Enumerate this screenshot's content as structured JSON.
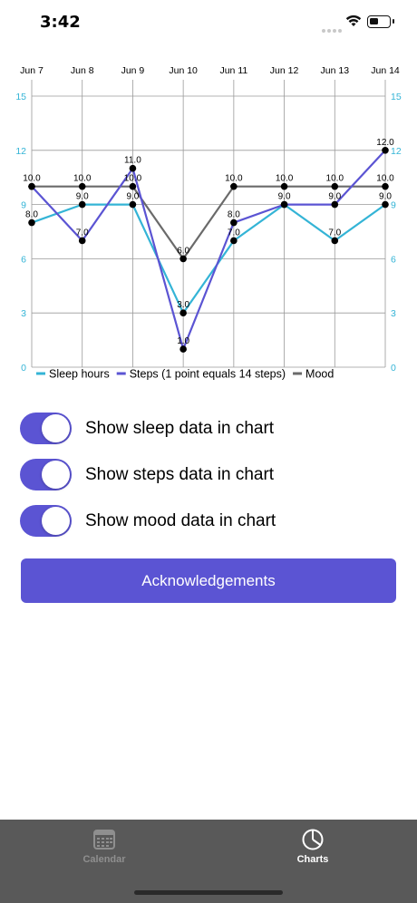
{
  "status": {
    "time": "3:42"
  },
  "chart_data": {
    "type": "line",
    "categories": [
      "Jun 7",
      "Jun 8",
      "Jun 9",
      "Jun 10",
      "Jun 11",
      "Jun 12",
      "Jun 13",
      "Jun 14"
    ],
    "ylim": [
      0,
      15
    ],
    "y_ticks": [
      "0",
      "3",
      "6",
      "9",
      "12",
      "15"
    ],
    "grid": true,
    "legend_position": "bottom",
    "series": [
      {
        "name": "Sleep hours",
        "color": "#34b4d6",
        "values": [
          8,
          9,
          9,
          3,
          7,
          9,
          7,
          9
        ]
      },
      {
        "name": "Steps (1 point equals 14 steps)",
        "color": "#5b54d3",
        "values": [
          10,
          7,
          11,
          1,
          8,
          9,
          9,
          12
        ]
      },
      {
        "name": "Mood",
        "color": "#6a6a6a",
        "values": [
          10,
          10,
          10,
          6,
          10,
          10,
          10,
          10
        ]
      }
    ],
    "value_labels": [
      [
        "10.0",
        "8.0"
      ],
      [
        "10.0",
        "9.0",
        "7.0"
      ],
      [
        "11.0",
        "10.0",
        "9.0"
      ],
      [
        "6.0",
        "3.0",
        "1.0"
      ],
      [
        "10.0",
        "8.0",
        "7.0"
      ],
      [
        "10.0",
        "9.0"
      ],
      [
        "10.0",
        "9.0",
        "7.0"
      ],
      [
        "12.0",
        "10.0",
        "9.0"
      ]
    ]
  },
  "toggles": [
    {
      "label": "Show sleep data in chart",
      "on": true
    },
    {
      "label": "Show steps data in chart",
      "on": true
    },
    {
      "label": "Show mood data in chart",
      "on": true
    }
  ],
  "acknowledgements_label": "Acknowledgements",
  "colors": {
    "accent": "#5b54d3",
    "tab_bar": "#595959"
  },
  "tabs": [
    {
      "label": "Calendar",
      "icon": "calendar-icon",
      "selected": false
    },
    {
      "label": "Charts",
      "icon": "pie-chart-icon",
      "selected": true
    }
  ]
}
